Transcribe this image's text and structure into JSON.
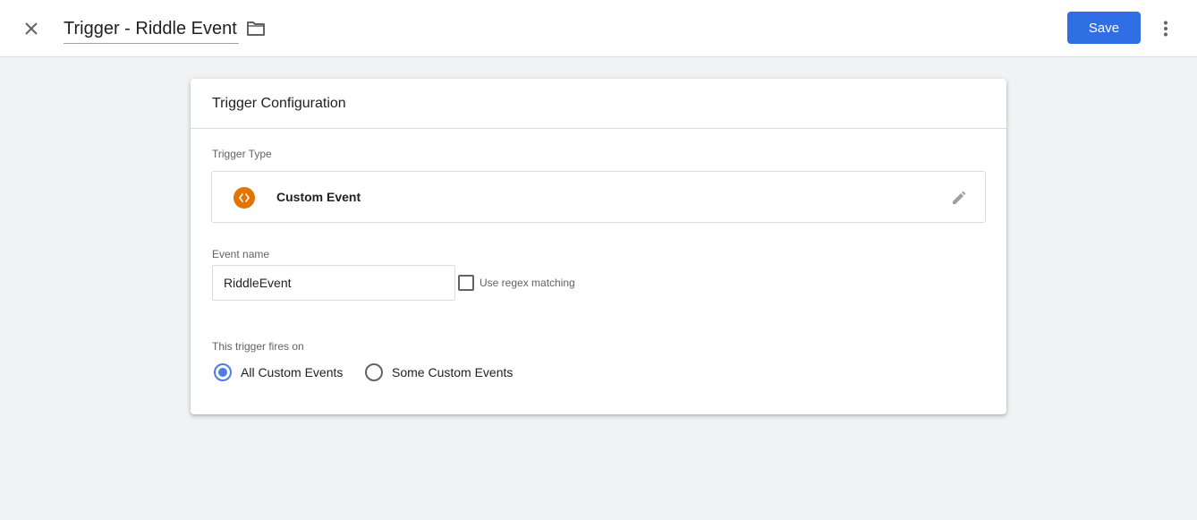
{
  "header": {
    "title": "Trigger - Riddle Event",
    "save_label": "Save",
    "icons": {
      "close": "close-icon",
      "folder": "folder-icon",
      "more": "more-vert-icon"
    }
  },
  "card": {
    "title": "Trigger Configuration",
    "trigger_type": {
      "label": "Trigger Type",
      "name": "Custom Event",
      "icon": "code-brackets-icon",
      "icon_color": "#e37400"
    },
    "event_name": {
      "label": "Event name",
      "value": "RiddleEvent"
    },
    "regex": {
      "label": "Use regex matching",
      "checked": false
    },
    "fires_on": {
      "label": "This trigger fires on",
      "options": [
        {
          "label": "All Custom Events",
          "selected": true
        },
        {
          "label": "Some Custom Events",
          "selected": false
        }
      ]
    }
  },
  "colors": {
    "accent": "#2f6fe3",
    "radio_selected": "#4a7de6",
    "background": "#f1f2f4"
  }
}
